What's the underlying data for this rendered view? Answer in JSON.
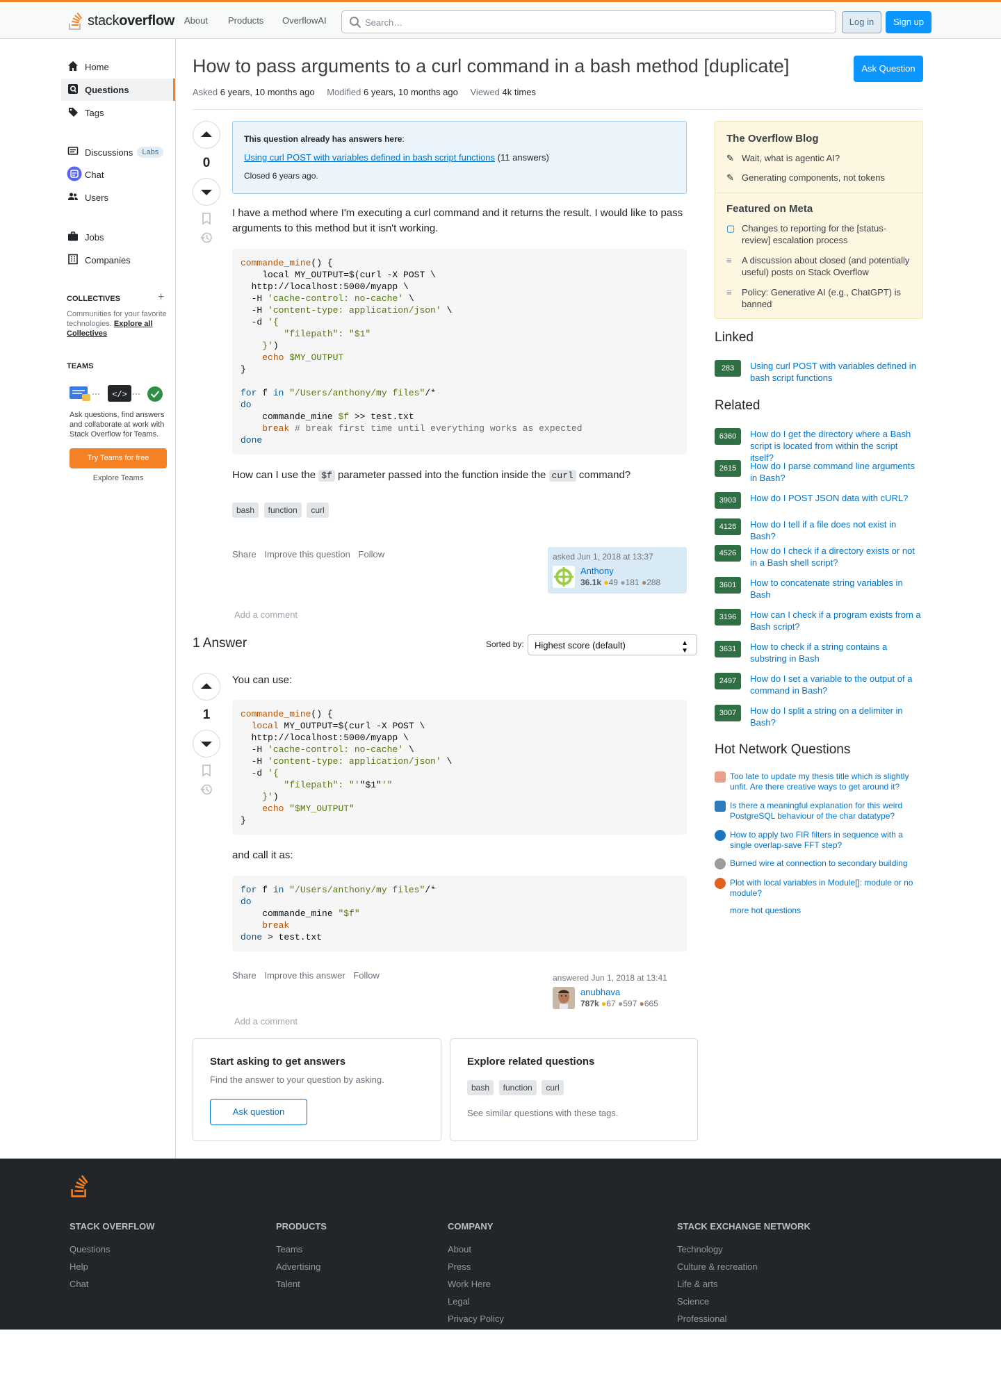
{
  "header": {
    "logo_text_light": "stack",
    "logo_text_bold": "overflow",
    "nav": [
      "About",
      "Products",
      "OverflowAI"
    ],
    "search_placeholder": "Search…",
    "login": "Log in",
    "signup": "Sign up"
  },
  "sidebar": {
    "items": [
      {
        "label": "Home",
        "icon": "home-icon"
      },
      {
        "label": "Questions",
        "icon": "questions-icon"
      },
      {
        "label": "Tags",
        "icon": "tag-icon"
      },
      {
        "label": "Discussions",
        "icon": "discussions-icon",
        "badge": "Labs"
      },
      {
        "label": "Chat",
        "icon": "chat-icon"
      },
      {
        "label": "Users",
        "icon": "users-icon"
      },
      {
        "label": "Jobs",
        "icon": "briefcase-icon"
      },
      {
        "label": "Companies",
        "icon": "building-icon"
      }
    ],
    "collectives_heading": "COLLECTIVES",
    "collectives_text": "Communities for your favorite technologies.",
    "collectives_link": "Explore all Collectives",
    "teams_heading": "TEAMS",
    "teams_text": "Ask questions, find answers and collaborate at work with Stack Overflow for Teams.",
    "teams_button": "Try Teams for free",
    "teams_explore": "Explore Teams"
  },
  "question": {
    "title": "How to pass arguments to a curl command in a bash method [duplicate]",
    "ask_button": "Ask Question",
    "asked_label": "Asked",
    "asked_value": "6 years, 10 months ago",
    "modified_label": "Modified",
    "modified_value": "6 years, 10 months ago",
    "viewed_label": "Viewed",
    "viewed_value": "4k times",
    "score": "0",
    "duplicate": {
      "heading": "This question already has answers here",
      "link": "Using curl POST with variables defined in bash script functions",
      "count": "(11 answers)",
      "closed": "Closed 6 years ago."
    },
    "body_intro": "I have a method where I'm executing a curl command and it returns the result. I would like to pass arguments to this method but it isn't working.",
    "body_question_pre": "How can I use the ",
    "body_code1": "$f",
    "body_question_mid": " parameter passed into the function inside the ",
    "body_code2": "curl",
    "body_question_post": " command?",
    "tags": [
      "bash",
      "function",
      "curl"
    ],
    "menu": [
      "Share",
      "Improve this question",
      "Follow"
    ],
    "asked_on": "asked Jun 1, 2018 at 13:37",
    "user": {
      "name": "Anthony",
      "rep": "36.1k",
      "gold": "49",
      "silver": "181",
      "bronze": "288"
    },
    "add_comment": "Add a comment"
  },
  "answers": {
    "heading": "1 Answer",
    "sort_label": "Sorted by:",
    "sort_value": "Highest score (default)",
    "answer": {
      "score": "1",
      "intro": "You can use:",
      "mid": "and call it as:",
      "menu": [
        "Share",
        "Improve this answer",
        "Follow"
      ],
      "answered_on": "answered Jun 1, 2018 at 13:41",
      "user": {
        "name": "anubhava",
        "rep": "787k",
        "gold": "67",
        "silver": "597",
        "bronze": "665"
      },
      "add_comment": "Add a comment"
    }
  },
  "bottom": {
    "card1_title": "Start asking to get answers",
    "card1_text": "Find the answer to your question by asking.",
    "card1_button": "Ask question",
    "card2_title": "Explore related questions",
    "card2_tags": [
      "bash",
      "function",
      "curl"
    ],
    "card2_text": "See similar questions with these tags."
  },
  "right": {
    "blog_heading": "The Overflow Blog",
    "blog_items": [
      "Wait, what is agentic AI?",
      "Generating components, not tokens"
    ],
    "meta_heading": "Featured on Meta",
    "meta_items": [
      "Changes to reporting for the [status-review] escalation process",
      "A discussion about closed (and potentially useful) posts on Stack Overflow",
      "Policy: Generative AI (e.g., ChatGPT) is banned"
    ],
    "linked_heading": "Linked",
    "linked": [
      {
        "score": "283",
        "title": "Using curl POST with variables defined in bash script functions"
      }
    ],
    "related_heading": "Related",
    "related": [
      {
        "score": "6360",
        "title": "How do I get the directory where a Bash script is located from within the script itself?"
      },
      {
        "score": "2615",
        "title": "How do I parse command line arguments in Bash?"
      },
      {
        "score": "3903",
        "title": "How do I POST JSON data with cURL?"
      },
      {
        "score": "4126",
        "title": "How do I tell if a file does not exist in Bash?"
      },
      {
        "score": "4526",
        "title": "How do I check if a directory exists or not in a Bash shell script?"
      },
      {
        "score": "3601",
        "title": "How to concatenate string variables in Bash"
      },
      {
        "score": "3196",
        "title": "How can I check if a program exists from a Bash script?"
      },
      {
        "score": "3631",
        "title": "How to check if a string contains a substring in Bash"
      },
      {
        "score": "2497",
        "title": "How do I set a variable to the output of a command in Bash?"
      },
      {
        "score": "3007",
        "title": "How do I split a string on a delimiter in Bash?"
      }
    ],
    "hnq_heading": "Hot Network Questions",
    "hnq": [
      {
        "title": "Too late to update my thesis title which is slightly unfit. Are there creative ways to get around it?",
        "color": "#e8a08a"
      },
      {
        "title": "Is there a meaningful explanation for this weird PostgreSQL behaviour of the char datatype?",
        "color": "#2f7dbf"
      },
      {
        "title": "How to apply two FIR filters in sequence with a single overlap-save FFT step?",
        "color": "#1b76c2"
      },
      {
        "title": "Burned wire at connection to secondary building",
        "color": "#9a9da0"
      },
      {
        "title": "Plot with local variables in Module[]: module or no module?",
        "color": "#e1611d"
      }
    ],
    "more_hot": "more hot questions"
  },
  "footer": {
    "cols": [
      {
        "heading": "STACK OVERFLOW",
        "links": [
          "Questions",
          "Help",
          "Chat"
        ]
      },
      {
        "heading": "PRODUCTS",
        "links": [
          "Teams",
          "Advertising",
          "Talent"
        ]
      },
      {
        "heading": "COMPANY",
        "links": [
          "About",
          "Press",
          "Work Here",
          "Legal",
          "Privacy Policy"
        ]
      },
      {
        "heading": "STACK EXCHANGE NETWORK",
        "links": [
          "Technology",
          "Culture & recreation",
          "Life & arts",
          "Science",
          "Professional"
        ]
      }
    ]
  },
  "colors": {
    "accent": "#f48225",
    "primary": "#0a95ff",
    "link": "#0074cc",
    "footer_bg": "#232629"
  }
}
